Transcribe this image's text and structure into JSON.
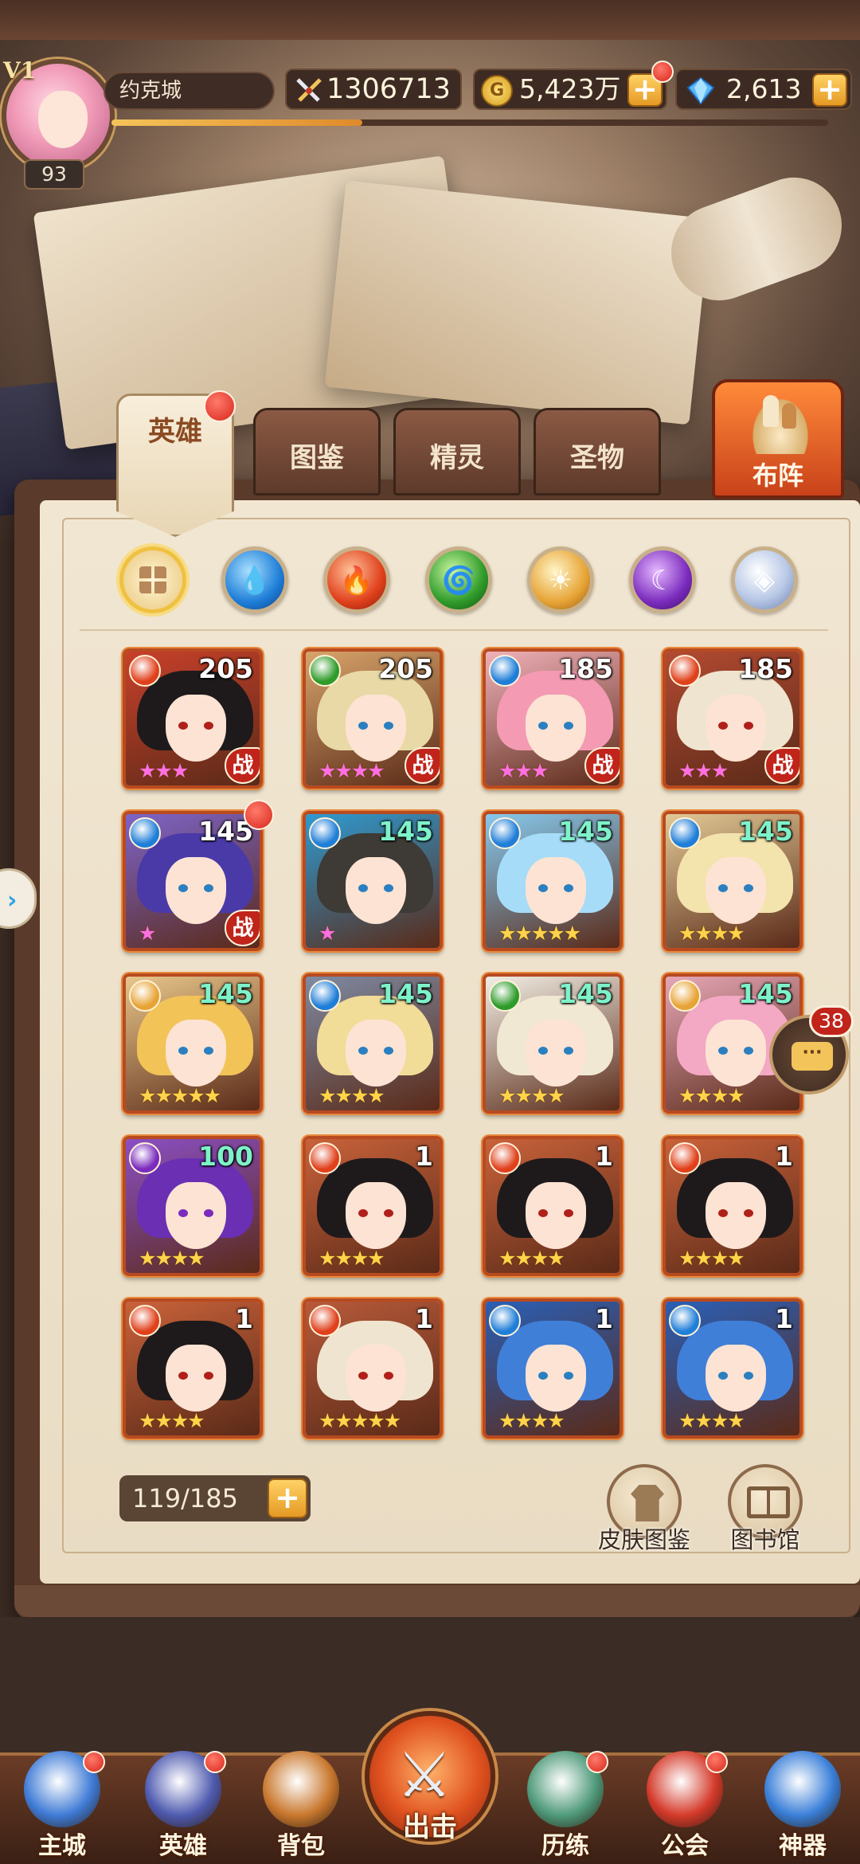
{
  "player": {
    "vip": "V1",
    "level": "93",
    "city": "约克城",
    "power": "1306713",
    "gold": "5,423万",
    "gold_icon": "G",
    "gems": "2,613"
  },
  "tabs": [
    {
      "label": "英雄",
      "active": true
    },
    {
      "label": "图鉴",
      "active": false
    },
    {
      "label": "精灵",
      "active": false
    },
    {
      "label": "圣物",
      "active": false
    }
  ],
  "formation_label": "布阵",
  "element_filters": [
    "all",
    "water",
    "fire",
    "wind",
    "light",
    "dark",
    "void"
  ],
  "heroes": [
    {
      "level": "205",
      "element": "fire",
      "stars": "★★★",
      "star_color": "pink",
      "battle": true,
      "max": false,
      "hair": "#1e1a1c",
      "bg": "#c8402a"
    },
    {
      "level": "205",
      "element": "wind",
      "stars": "★★★★",
      "star_color": "pink",
      "battle": true,
      "max": false,
      "hair": "#e8d9a6",
      "bg": "#d7a46a"
    },
    {
      "level": "185",
      "element": "water",
      "stars": "★★★",
      "star_color": "pink",
      "battle": true,
      "max": false,
      "hair": "#f49ab3",
      "bg": "#f0b1b9"
    },
    {
      "level": "185",
      "element": "fire",
      "stars": "★★★",
      "star_color": "pink",
      "battle": true,
      "max": false,
      "hair": "#efe4cf",
      "bg": "#b34a32"
    },
    {
      "level": "145",
      "element": "water",
      "stars": "★",
      "star_color": "pink",
      "battle": true,
      "max": false,
      "hair": "#4a3aa8",
      "bg": "#7d64c8",
      "red_dot": true
    },
    {
      "level": "145",
      "element": "water",
      "stars": "★",
      "star_color": "pink",
      "battle": false,
      "max": true,
      "hair": "#3e3a36",
      "bg": "#2f9ad0"
    },
    {
      "level": "145",
      "element": "water",
      "stars": "★★★★★",
      "star_color": "gold",
      "battle": false,
      "max": true,
      "hair": "#a6dcf7",
      "bg": "#86c9ee"
    },
    {
      "level": "145",
      "element": "water",
      "stars": "★★★★",
      "star_color": "gold",
      "battle": false,
      "max": true,
      "hair": "#f3e3ad",
      "bg": "#e2c996"
    },
    {
      "level": "145",
      "element": "light",
      "stars": "★★★★★",
      "star_color": "gold",
      "battle": false,
      "max": true,
      "hair": "#f2c357",
      "bg": "#e8c68a"
    },
    {
      "level": "145",
      "element": "water",
      "stars": "★★★★",
      "star_color": "gold",
      "battle": false,
      "max": true,
      "hair": "#f1dc98",
      "bg": "#7e8aa2"
    },
    {
      "level": "145",
      "element": "wind",
      "stars": "★★★★",
      "star_color": "gold",
      "battle": false,
      "max": true,
      "hair": "#f0e8d2",
      "bg": "#f2eee4"
    },
    {
      "level": "145",
      "element": "light",
      "stars": "★★★★",
      "star_color": "gold",
      "battle": false,
      "max": true,
      "hair": "#f3a8c4",
      "bg": "#e6a7b6"
    },
    {
      "level": "100",
      "element": "dark",
      "stars": "★★★★",
      "star_color": "gold",
      "battle": false,
      "max": true,
      "hair": "#6a2fb2",
      "bg": "#8b4fc4"
    },
    {
      "level": "1",
      "element": "fire",
      "stars": "★★★★",
      "star_color": "gold",
      "battle": false,
      "max": false,
      "hair": "#1e1a1c",
      "bg": "#c9623a"
    },
    {
      "level": "1",
      "element": "fire",
      "stars": "★★★★",
      "star_color": "gold",
      "battle": false,
      "max": false,
      "hair": "#1e1a1c",
      "bg": "#c9623a"
    },
    {
      "level": "1",
      "element": "fire",
      "stars": "★★★★",
      "star_color": "gold",
      "battle": false,
      "max": false,
      "hair": "#1e1a1c",
      "bg": "#c9623a"
    },
    {
      "level": "1",
      "element": "fire",
      "stars": "★★★★",
      "star_color": "gold",
      "battle": false,
      "max": false,
      "hair": "#1e1a1c",
      "bg": "#c9623a"
    },
    {
      "level": "1",
      "element": "fire",
      "stars": "★★★★★",
      "star_color": "gold",
      "battle": false,
      "max": false,
      "hair": "#efe4cf",
      "bg": "#b85a3a"
    },
    {
      "level": "1",
      "element": "water",
      "stars": "★★★★",
      "star_color": "gold",
      "battle": false,
      "max": false,
      "hair": "#3f7fd8",
      "bg": "#2a5fb6"
    },
    {
      "level": "1",
      "element": "water",
      "stars": "★★★★",
      "star_color": "gold",
      "battle": false,
      "max": false,
      "hair": "#3f7fd8",
      "bg": "#2a5fb6"
    }
  ],
  "battle_label": "战",
  "capacity": "119/185",
  "skins_label": "皮肤图鉴",
  "library_label": "图书馆",
  "chat_count": "38",
  "nav": [
    {
      "label": "主城",
      "icon": "castle-icon",
      "color": "#3f7bd6",
      "red_dot": true
    },
    {
      "label": "英雄",
      "icon": "helmet-icon",
      "color": "#4f5bb0",
      "red_dot": true
    },
    {
      "label": "背包",
      "icon": "backpack-icon",
      "color": "#c9782e",
      "red_dot": false
    },
    {
      "label": "历练",
      "icon": "emblem-icon",
      "color": "#4f9a7a",
      "red_dot": true
    },
    {
      "label": "公会",
      "icon": "guild-banner-icon",
      "color": "#d43a2a",
      "red_dot": true
    },
    {
      "label": "神器",
      "icon": "orb-icon",
      "color": "#3a7fd8",
      "red_dot": false
    }
  ],
  "nav_main_label": "出击",
  "colors": {
    "fire": "#e0411c",
    "water": "#1f7ed8",
    "wind": "#2f9b2a",
    "light": "#e7a436",
    "dark": "#7b2bbd",
    "void": "#b8c8e6"
  }
}
